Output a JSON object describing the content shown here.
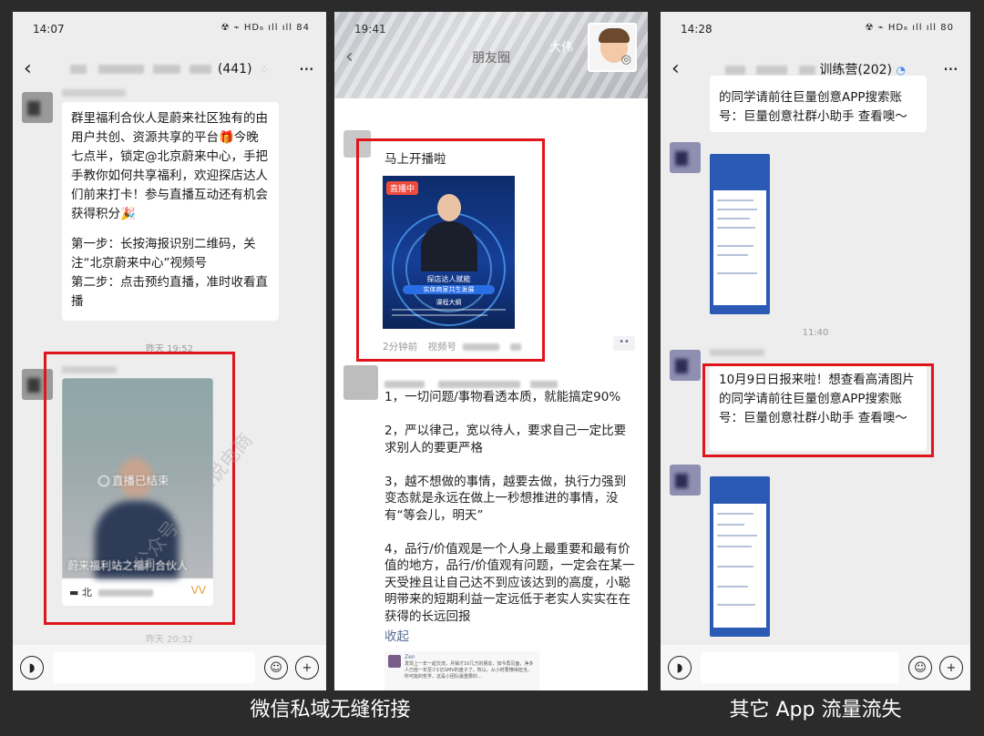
{
  "phone1": {
    "status_time": "14:07",
    "status_icons": "☢ ⌁ HD₆ ıll ıll 84",
    "chat_title_suffix": "(441)",
    "message1": "群里福利合伙人是蔚来社区独有的由用户共创、资源共享的平台🎁今晚七点半，锁定@北京蔚来中心，手把手教你如何共享福利，欢迎探店达人们前来打卡！参与直播互动还有机会获得积分🎉",
    "message1_steps": "第一步：长按海报识别二维码，关注“北京蔚来中心”视频号\n第二步：点击预约直播，准时收看直播",
    "timestamp1": "昨天 19:52",
    "live_status": "直播已结束",
    "live_title": "蔚来福利站之福利合伙人",
    "live_channel": "北",
    "timestamp2": "昨天 20:32",
    "watermark": "公众号：大伟说电商"
  },
  "phone2": {
    "status_time": "19:41",
    "user_name": "大伟",
    "page_title": "朋友圈",
    "post1_text": "马上开播啦",
    "live_badge": "直播中",
    "poster_title": "探店达人赋能",
    "poster_subtitle": "实体商家共生发展",
    "poster_outline": "课程大纲",
    "post1_time": "2分钟前",
    "post1_source": "视频号",
    "post2_text": "1，一切问题/事物看透本质，就能搞定90%\n\n2，严以律己，宽以待人，要求自己一定比要求别人的要更严格\n\n3，越不想做的事情，越要去做，执行力强到变态就是永远在做上一秒想推进的事情，没有“等会儿，明天”\n\n4，品行/价值观是一个人身上最重要和最有价值的地方，品行/价值观有问题，一定会在某一天受挫且让自己达不到应该达到的高度，小聪明带来的短期利益一定远低于老实人实实在在获得的长远回报",
    "collapse_label": "收起",
    "comment_name": "Zen",
    "comment_text": "发现上一年一起交流，月销才10几万的朋友，如今再见面，净多人已经一年至少1亿GMV的盘子了。所以，从小时要懂得担当，所可能的哲学，这是小团队最重要的…"
  },
  "phone3": {
    "status_time": "14:28",
    "status_icons": "☢ ⌁ HD₆ ıll ıll 80",
    "chat_title": "训练营(202)",
    "top_bubble": "的同学请前往巨量创意APP搜索账号：巨量创意社群小助手 查看噢～",
    "timestamp": "11:40",
    "highlight_bubble": "10月9日日报来啦！想查看高清图片的同学请前往巨量创意APP搜索账号：巨量创意社群小助手 查看噢～"
  },
  "captions": {
    "left": "微信私域无缝衔接",
    "right": "其它 App 流量流失"
  },
  "colors": {
    "highlight_red": "#e0151c",
    "chat_bg": "#ededed",
    "link_blue": "#576b95"
  }
}
